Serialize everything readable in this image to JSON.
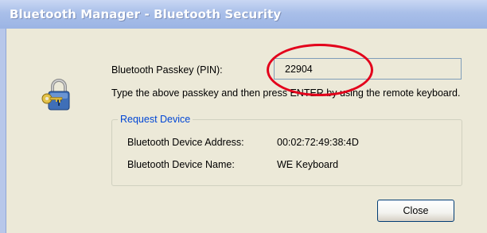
{
  "window": {
    "title": "Bluetooth Manager - Bluetooth Security"
  },
  "passkey": {
    "label": "Bluetooth Passkey (PIN):",
    "value": "22904"
  },
  "instruction": "Type the above passkey and then press ENTER by using the remote keyboard.",
  "request_device": {
    "title": "Request Device",
    "address_label": "Bluetooth Device Address:",
    "address_value": "00:02:72:49:38:4D",
    "name_label": "Bluetooth Device Name:",
    "name_value": "WE Keyboard"
  },
  "buttons": {
    "close": "Close"
  },
  "icons": {
    "security": "padlock-key-icon"
  },
  "colors": {
    "title_bar": "#a9bfe9",
    "dialog_bg": "#ece9d8",
    "group_title": "#0046d5",
    "annotation": "#e3001b"
  }
}
